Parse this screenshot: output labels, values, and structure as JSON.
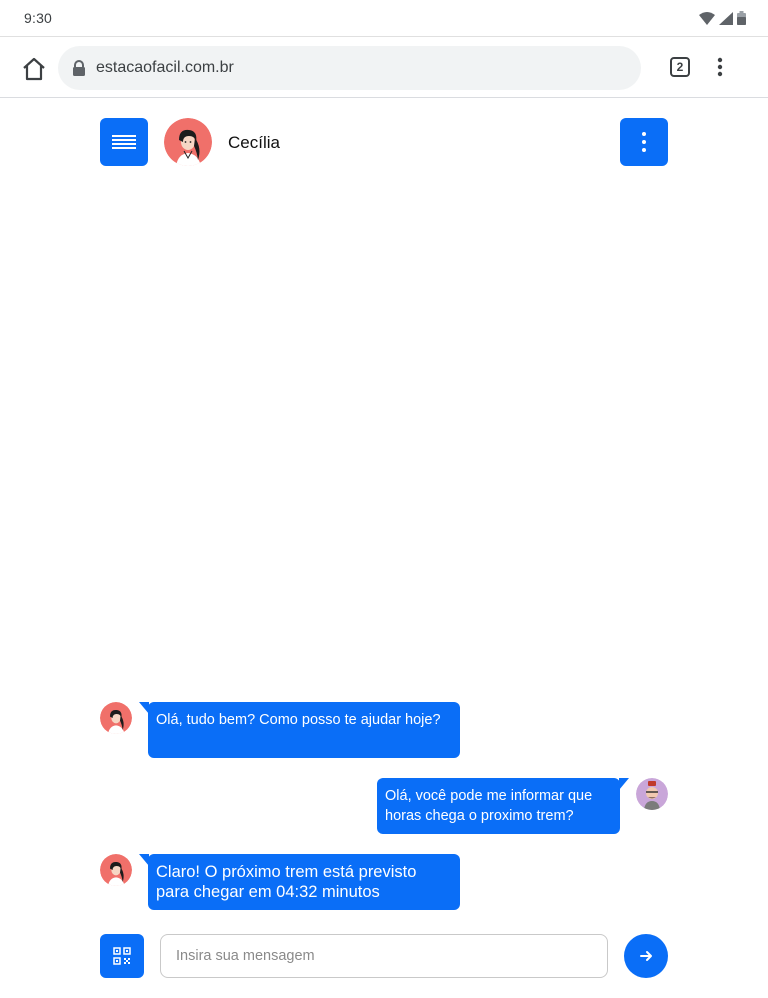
{
  "status_bar": {
    "time": "9:30"
  },
  "browser": {
    "url": "estacaofacil.com.br",
    "tab_count": "2"
  },
  "chat": {
    "contact_name": "Cecília",
    "messages": [
      {
        "sender": "Cecília",
        "side": "left",
        "text": "Olá, tudo bem? Como posso te ajudar hoje?"
      },
      {
        "sender": "user",
        "side": "right",
        "text": "Olá, você pode me informar que horas chega o proximo trem?"
      },
      {
        "sender": "Cecília",
        "side": "left",
        "text": "Claro! O próximo trem está previsto para chegar em 04:32 minutos"
      }
    ]
  },
  "composer": {
    "placeholder": "Insira sua mensagem",
    "value": ""
  },
  "colors": {
    "accent": "#0a6ef7",
    "bot_avatar_bg": "#f0706a",
    "user_avatar_bg": "#c9a6d9"
  },
  "icons": {
    "home": "home-icon",
    "lock": "lock-icon",
    "tabs": "tabs-icon",
    "overflow": "more-vert-icon",
    "menu": "menu-lines-icon",
    "more": "more-vert-icon",
    "qr": "qr-code-icon",
    "send": "arrow-right-icon"
  }
}
